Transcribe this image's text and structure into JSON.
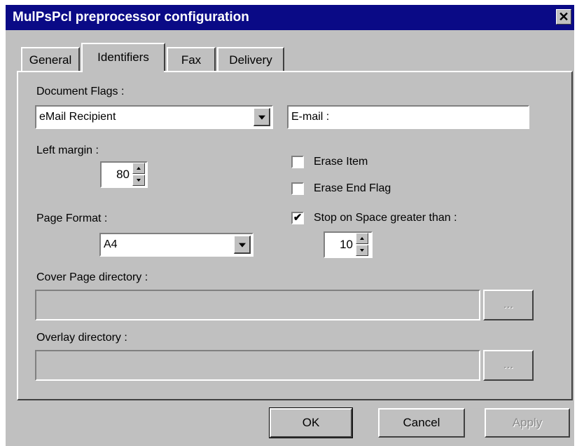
{
  "window": {
    "title": "MulPsPcl preprocessor configuration",
    "close_glyph": "✕"
  },
  "tabs": [
    {
      "label": "General",
      "active": false
    },
    {
      "label": "Identifiers",
      "active": true
    },
    {
      "label": "Fax",
      "active": false
    },
    {
      "label": "Delivery",
      "active": false
    }
  ],
  "document_flags": {
    "label": "Document Flags :",
    "selected": "eMail Recipient",
    "text_value": "E-mail :"
  },
  "left_margin": {
    "label": "Left margin :",
    "value": "80"
  },
  "erase_item": {
    "label": "Erase Item",
    "checked": false
  },
  "erase_end_flag": {
    "label": "Erase End Flag",
    "checked": false
  },
  "page_format": {
    "label": "Page Format :",
    "selected": "A4"
  },
  "stop_on_space": {
    "label": "Stop on Space greater than :",
    "checked": true,
    "check_glyph": "✔",
    "value": "10"
  },
  "cover_page_dir": {
    "label": "Cover Page directory :",
    "value": "",
    "browse_label": "..."
  },
  "overlay_dir": {
    "label": "Overlay directory :",
    "value": "",
    "browse_label": "..."
  },
  "buttons": {
    "ok": "OK",
    "cancel": "Cancel",
    "apply": "Apply"
  }
}
